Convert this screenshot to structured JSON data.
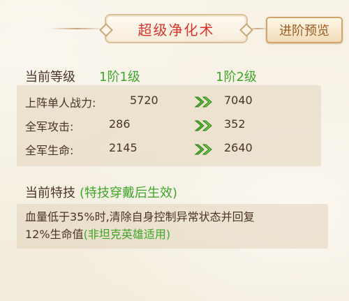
{
  "title": "超级净化术",
  "preview_button": "进阶预览",
  "level": {
    "label": "当前等级",
    "current": "1阶1级",
    "next": "1阶2级"
  },
  "stats": [
    {
      "label": "上阵单人战力:",
      "current": "5720",
      "next": "7040"
    },
    {
      "label": "全军攻击:",
      "current": "286",
      "next": "352"
    },
    {
      "label": "全军生命:",
      "current": "2145",
      "next": "2640"
    }
  ],
  "skill": {
    "title": "当前特技",
    "note": "(特技穿戴后生效)",
    "desc_line1": "血量低于35%时,清除自身控制异常状态并回复",
    "desc_line2": "12%生命值",
    "desc_note": "(非坦克英雄适用)"
  },
  "colors": {
    "title_red": "#d9342b",
    "value_green": "#3fa52a",
    "text_brown": "#4a3424"
  },
  "icons": {
    "arrow": "double-chevron-right-icon"
  }
}
